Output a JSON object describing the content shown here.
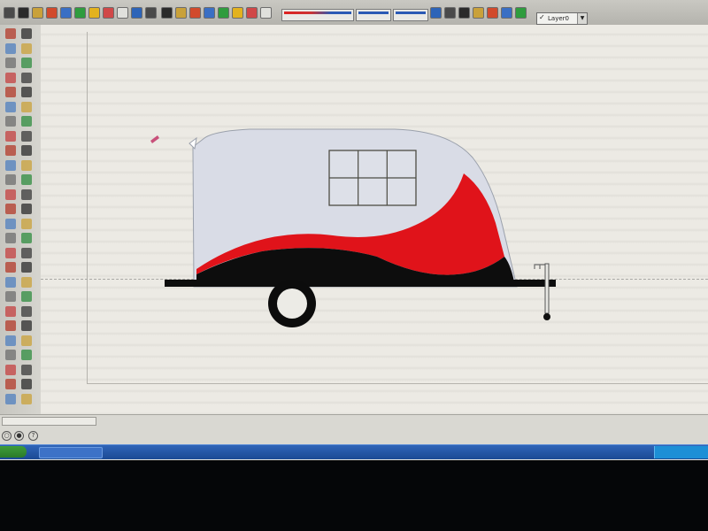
{
  "app": {
    "toolbar": {
      "style_label": "",
      "readout_a": "",
      "readout_b": "",
      "layer": {
        "selected": "Layer0"
      },
      "button_colors": [
        "#4a4a4a",
        "#2a2a2a",
        "#c9a13a",
        "#d14a2c",
        "#3a6fc4",
        "#2f9c3e",
        "#e3b21e",
        "#d04848",
        "#e0e0dc",
        "#2d64b8"
      ]
    },
    "palette": {
      "tool_colors": [
        "#b33a2a",
        "#2b2b2b",
        "#4f7fbf",
        "#c9a23a",
        "#6d6d6d",
        "#2f8c3f",
        "#c44040",
        "#3a3a3a"
      ]
    },
    "drawing": {
      "body_color": "#d9dce6",
      "red_swoosh_color": "#e0131a",
      "black_swoosh_color": "#0d0d0d",
      "window": {
        "rows": 2,
        "cols": 3,
        "frame_color": "#4d4d44"
      },
      "wheel": {
        "tire_color": "#0c0c0c",
        "hub_color": "#ecebe6"
      }
    }
  }
}
